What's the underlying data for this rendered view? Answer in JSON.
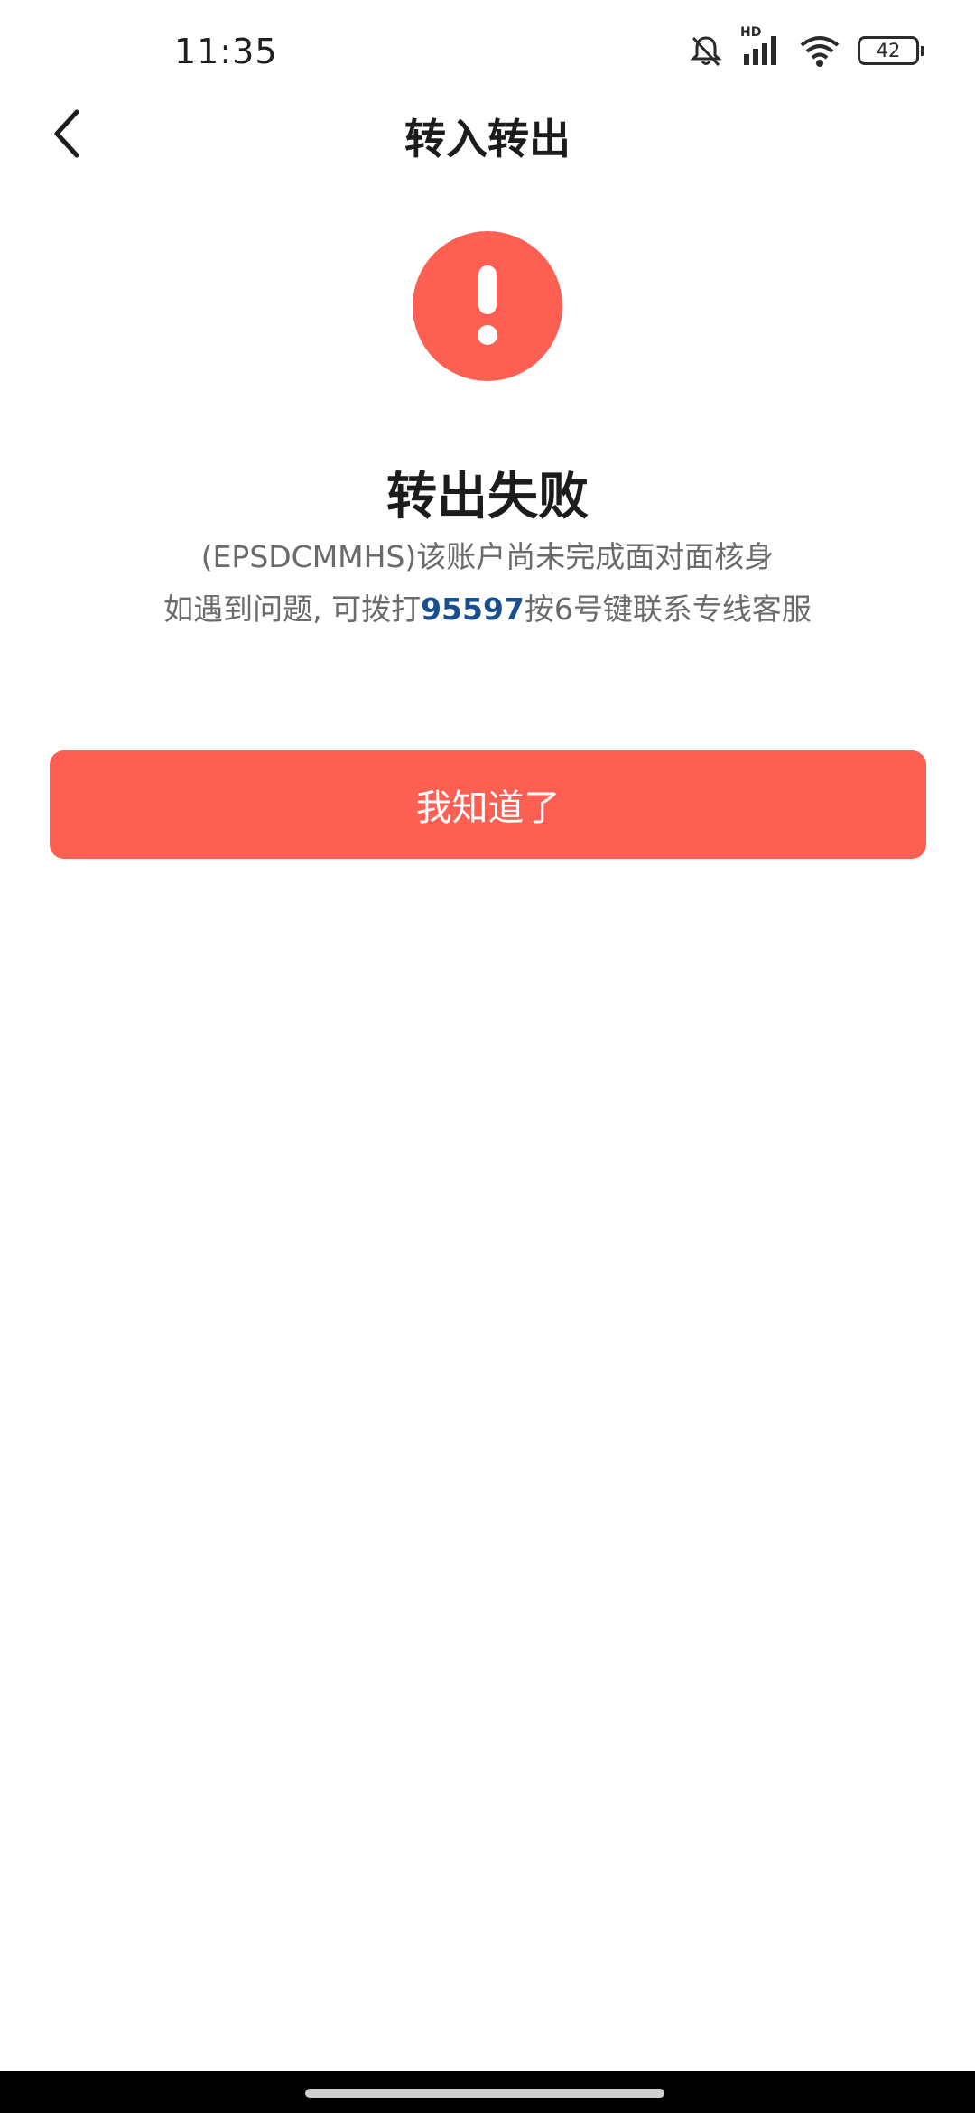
{
  "status_bar": {
    "time": "11:35",
    "network_label": "HD",
    "battery_level": "42",
    "icons": [
      "bell-muted-icon",
      "signal-icon",
      "wifi-icon",
      "battery-icon"
    ]
  },
  "nav": {
    "title": "转入转出",
    "back_icon": "chevron-left-icon"
  },
  "result": {
    "icon": "exclamation-circle-icon",
    "icon_color": "#fd5f53",
    "title": "转出失败",
    "message_line1": "(EPSDCMMHS)该账户尚未完成面对面核身",
    "message_line2_prefix": "如遇到问题, 可拨打",
    "phone_number": "95597",
    "message_line2_suffix": "按6号键联系专线客服",
    "phone_color": "#1a4f8e"
  },
  "actions": {
    "confirm_label": "我知道了",
    "confirm_color": "#fd5f53"
  }
}
